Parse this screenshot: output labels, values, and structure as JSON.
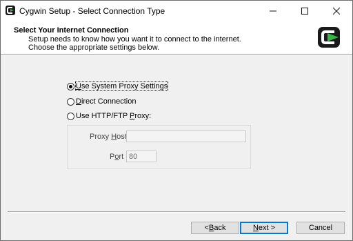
{
  "window": {
    "title": "Cygwin Setup - Select Connection Type"
  },
  "header": {
    "title": "Select Your Internet Connection",
    "description": "Setup needs to know how you want it to connect to the internet.  Choose the appropriate settings below."
  },
  "options": [
    {
      "pre": "",
      "accel": "U",
      "post": "se System Proxy Settings",
      "selected": true
    },
    {
      "pre": "",
      "accel": "D",
      "post": "irect Connection",
      "selected": false
    },
    {
      "pre": "Use HTTP/FTP ",
      "accel": "P",
      "post": "roxy:",
      "selected": false
    }
  ],
  "proxy": {
    "host_label_pre": "Proxy ",
    "host_label_accel": "H",
    "host_label_post": "ost",
    "host_value": "",
    "port_label_pre": "P",
    "port_label_accel": "o",
    "port_label_post": "rt",
    "port_value": "80"
  },
  "buttons": {
    "back": {
      "pre": "< ",
      "accel": "B",
      "post": "ack"
    },
    "next": {
      "pre": "",
      "accel": "N",
      "post": "ext >"
    },
    "cancel": "Cancel"
  },
  "colors": {
    "accent": "#0078d7",
    "logo_green": "#39b54a",
    "logo_dark": "#1a1a1a"
  }
}
